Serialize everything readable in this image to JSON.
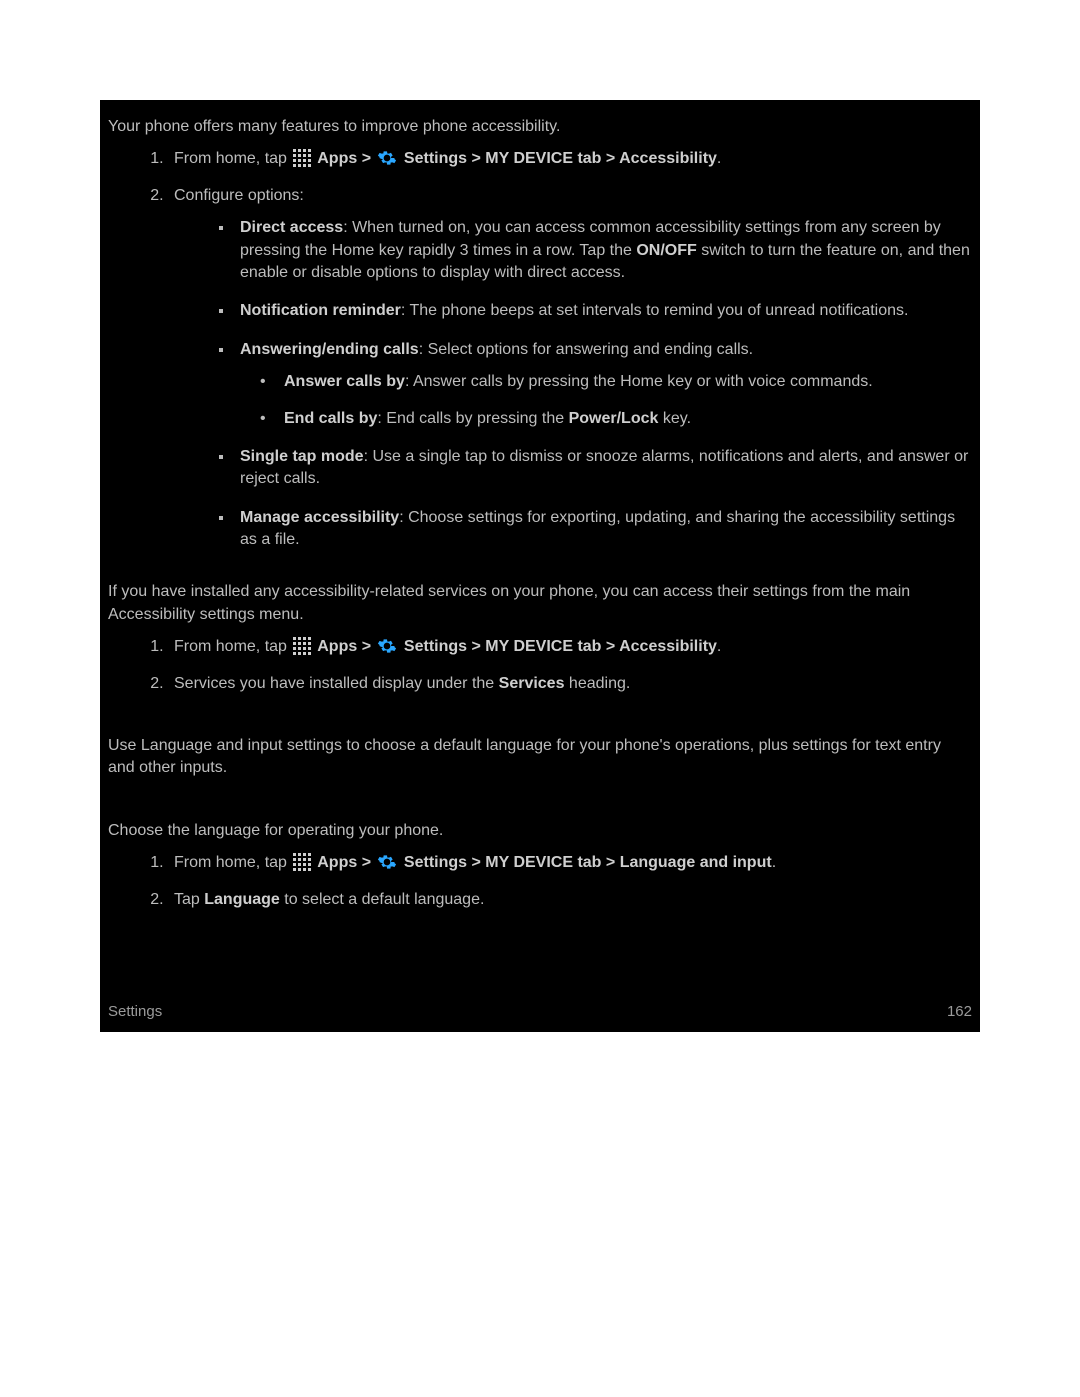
{
  "intro": "Your phone offers many features to improve phone accessibility.",
  "nav": {
    "from_home_tap": "From home, tap",
    "apps": " Apps",
    "sep": " > ",
    "settings": " Settings",
    "mydevice_tab": " > MY DEVICE tab > ",
    "accessibility": "Accessibility",
    "lang_input": "Language and input"
  },
  "step2_configure": "Configure options:",
  "opts": {
    "direct_access_b": "Direct access",
    "direct_access_t1": ": When turned on, you can access common accessibility settings from any screen by pressing the Home key rapidly 3 times in a row. Tap the ",
    "onoff": "ON/OFF",
    "direct_access_t2": " switch to turn the feature on, and then enable or disable options to display with direct access.",
    "notif_b": "Notification reminder",
    "notif_t": ": The phone beeps at set intervals to remind you of unread notifications.",
    "ans_end_b": "Answering/ending calls",
    "ans_end_t": ": Select options for answering and ending calls.",
    "ans_by_b": "Answer calls by",
    "ans_by_t": ": Answer calls by pressing the Home key or with voice commands.",
    "end_by_b": "End calls by",
    "end_by_t1": ": End calls by pressing the ",
    "powerlock": "Power/Lock",
    "end_by_t2": " key.",
    "single_tap_b": "Single tap mode",
    "single_tap_t": ": Use a single tap to dismiss or snooze alarms, notifications and alerts, and answer or reject calls.",
    "manage_b": "Manage accessibility",
    "manage_t": ": Choose settings for exporting, updating, and sharing the accessibility settings as a file."
  },
  "services_intro": "If you have installed any accessibility-related services on your phone, you can access their settings from the main Accessibility settings menu.",
  "services_step2_a": "Services you have installed display under the ",
  "services_word": "Services",
  "services_step2_b": " heading.",
  "lang_intro": "Use Language and input settings to choose a default language for your phone's operations, plus settings for text entry and other inputs.",
  "lang_sub": "Choose the language for operating your phone.",
  "lang_step2_a": "Tap ",
  "language_word": "Language",
  "lang_step2_b": " to select a default language.",
  "footer": {
    "left": "Settings",
    "right": "162"
  }
}
